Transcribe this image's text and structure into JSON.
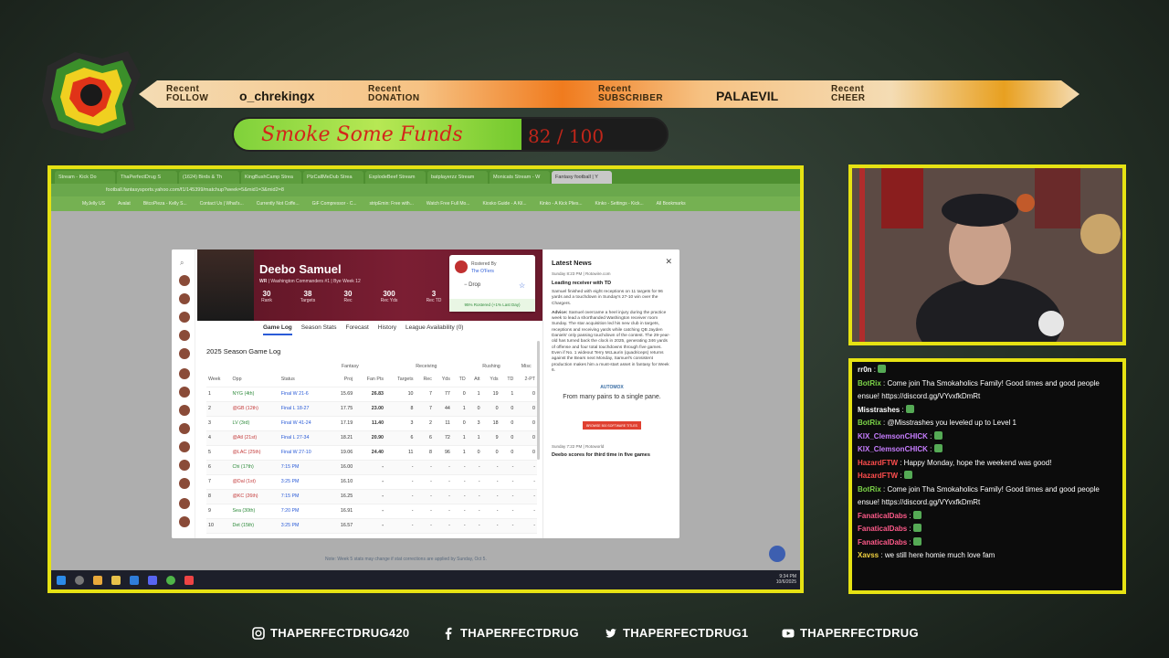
{
  "banner": {
    "items": [
      {
        "label_top": "Recent",
        "label_bottom": "FOLLOW",
        "name": "o_chrekingx"
      },
      {
        "label_top": "Recent",
        "label_bottom": "DONATION",
        "name": ""
      },
      {
        "label_top": "Recent",
        "label_bottom": "SUBSCRIBER",
        "name": "PALAEVIL"
      },
      {
        "label_top": "Recent",
        "label_bottom": "CHEER",
        "name": ""
      }
    ]
  },
  "funds": {
    "title": "Smoke Some Funds",
    "count": "82 / 100",
    "progress": 0.82
  },
  "browser": {
    "tabs": [
      "Stream - Kick Do",
      "ThaPerfectDrug S",
      "(1624) Birds & Th",
      "KingBushCamp Strea",
      "PlzCallMeDub Strea",
      "ExplodeBeef Stream",
      "batplayerzz Stream",
      "Monicats Stream - W",
      "Fantasy football | Y"
    ],
    "url": "football.fantasysports.yahoo.com/f1/145399/matchup?week=5&mid1=3&mid2=8",
    "bookmarks": [
      "MyJelly US",
      "Avalat",
      "BitcoPieza - Kelly S...",
      "Contact Us | What's...",
      "Currently Not Coffe...",
      "GiF Compressor - C...",
      "stripEmin: Free with...",
      "Watch Free Full Mo...",
      "Kiosko Guide - A Kil...",
      "Kinko - A Kick Plies...",
      "Kinko - Settings - Kick...",
      "All Bookmarks"
    ],
    "taskbar_time": "9:34 PM",
    "taskbar_date": "10/6/2025",
    "footer_note": "Note: Week 5 stats may change if stat corrections are applied by Sunday, Oct 5."
  },
  "player": {
    "name": "Deebo Samuel",
    "position": "WR",
    "team": "Washington Commanders #1",
    "bye": "Bye Week 12",
    "stats": [
      {
        "value": "30",
        "label": "Rank"
      },
      {
        "value": "38",
        "label": "Targets"
      },
      {
        "value": "30",
        "label": "Rec"
      },
      {
        "value": "300",
        "label": "Rec Yds"
      },
      {
        "value": "3",
        "label": "Rec TD"
      }
    ],
    "rostered_label": "Rostered By",
    "rostered_team": "The O'Fers",
    "drop_label": "Drop",
    "rostered_pct": "95% Rostered (+1% Last Day)"
  },
  "modal_tabs": [
    "Game Log",
    "Season Stats",
    "Forecast",
    "History",
    "League Availability (0)"
  ],
  "game_log": {
    "title": "2025 Season Game Log",
    "group_headers": [
      "Fantasy",
      "Receiving",
      "Rushing",
      "Misc"
    ],
    "columns": [
      "Week",
      "Opp",
      "Status",
      "Proj",
      "Fan Pts",
      "Targets",
      "Rec",
      "Yds",
      "TD",
      "Att",
      "Yds",
      "TD",
      "2-PT"
    ],
    "rows": [
      [
        "1",
        "NYG (4th)",
        "Final W 21-6",
        "15.69",
        "26.83",
        "10",
        "7",
        "77",
        "0",
        "1",
        "19",
        "1",
        "0"
      ],
      [
        "2",
        "@GB (12th)",
        "Final L 18-27",
        "17.75",
        "23.00",
        "8",
        "7",
        "44",
        "1",
        "0",
        "0",
        "0",
        "0"
      ],
      [
        "3",
        "LV (3rd)",
        "Final W 41-24",
        "17.19",
        "11.40",
        "3",
        "2",
        "11",
        "0",
        "3",
        "18",
        "0",
        "0"
      ],
      [
        "4",
        "@Atl (21st)",
        "Final L 27-34",
        "18.21",
        "20.90",
        "6",
        "6",
        "72",
        "1",
        "1",
        "9",
        "0",
        "0"
      ],
      [
        "5",
        "@LAC (25th)",
        "Final W 27-10",
        "19.06",
        "24.40",
        "11",
        "8",
        "96",
        "1",
        "0",
        "0",
        "0",
        "0"
      ],
      [
        "6",
        "Chi (17th)",
        "7:15 PM",
        "16.00",
        "-",
        "-",
        "-",
        "-",
        "-",
        "-",
        "-",
        "-",
        "-"
      ],
      [
        "7",
        "@Dal (1st)",
        "3:25 PM",
        "16.10",
        "-",
        "-",
        "-",
        "-",
        "-",
        "-",
        "-",
        "-",
        "-"
      ],
      [
        "8",
        "@KC (26th)",
        "7:15 PM",
        "16.25",
        "-",
        "-",
        "-",
        "-",
        "-",
        "-",
        "-",
        "-",
        "-"
      ],
      [
        "9",
        "Sea (30th)",
        "7:20 PM",
        "16.91",
        "-",
        "-",
        "-",
        "-",
        "-",
        "-",
        "-",
        "-",
        "-"
      ],
      [
        "10",
        "Det (15th)",
        "3:25 PM",
        "16.57",
        "-",
        "-",
        "-",
        "-",
        "-",
        "-",
        "-",
        "-",
        "-"
      ]
    ]
  },
  "news": {
    "heading": "Latest News",
    "date": "Sunday 8:23 PM | Rotowire.com",
    "headline": "Leading receiver with TD",
    "body": "Samuel finished with eight receptions on 11 targets for 96 yards and a touchdown in Sunday's 27-10 win over the Chargers.",
    "advice_label": "Advice:",
    "advice": "Samuel overcame a heel injury during the practice week to lead a shorthanded Washington receiver room Sunday. The star acquisition led his new club in targets, receptions and receiving yards while catching QB Jayden Daniels' only passing touchdown of the contest. The 29-year-old has turned back the clock in 2025, generating 346 yards of offense and four total touchdowns through five games. Even if No. 1 wideout Terry McLaurin (quadriceps) returns against the Bears next Monday, Samuel's consistent production makes him a must-start asset in fantasy for Week 6.",
    "ad_brand": "AUTOMOX",
    "ad_text": "From many pains to a single pane.",
    "ad_button": "BROWSE 500 SOFTWARE TITLES",
    "date2": "Sunday 7:22 PM | Rotoworld",
    "headline2": "Deebo scores for third time in five games"
  },
  "chat": [
    {
      "user": "rr0n",
      "color": "#ffffff",
      "text": ""
    },
    {
      "user": "BotRix",
      "color": "#7cd548",
      "text": "Come join Tha Smokaholics Family! Good times and good people ensue! https://discord.gg/VYvxfkDmRt"
    },
    {
      "user": "Misstrashes",
      "color": "#ffffff",
      "text": ""
    },
    {
      "user": "BotRix",
      "color": "#7cd548",
      "text": "@Misstrashes you leveled up to Level 1"
    },
    {
      "user": "KIX_ClemsonCHICK",
      "color": "#c77dff",
      "text": ""
    },
    {
      "user": "KIX_ClemsonCHICK",
      "color": "#c77dff",
      "text": ""
    },
    {
      "user": "HazardFTW",
      "color": "#ff4d4d",
      "text": "Happy Monday, hope the weekend was good!"
    },
    {
      "user": "HazardFTW",
      "color": "#ff4d4d",
      "text": ""
    },
    {
      "user": "BotRix",
      "color": "#7cd548",
      "text": "Come join Tha Smokaholics Family! Good times and good people ensue! https://discord.gg/VYvxfkDmRt"
    },
    {
      "user": "FanaticalDabs",
      "color": "#ff5a8a",
      "text": ""
    },
    {
      "user": "FanaticalDabs",
      "color": "#ff5a8a",
      "text": ""
    },
    {
      "user": "FanaticalDabs",
      "color": "#ff5a8a",
      "text": ""
    },
    {
      "user": "Xavss",
      "color": "#f0d040",
      "text": "we still here homie much love fam"
    }
  ],
  "socials": [
    {
      "icon": "instagram-icon",
      "handle": "THAPERFECTDRUG420"
    },
    {
      "icon": "facebook-icon",
      "handle": "THAPERFECTDRUG"
    },
    {
      "icon": "twitter-icon",
      "handle": "THAPERFECTDRUG1"
    },
    {
      "icon": "youtube-icon",
      "handle": "THAPERFECTDRUG"
    }
  ],
  "colors": {
    "frame": "#e6e213",
    "hero": "#7b1e33",
    "link": "#2a5bd7",
    "chrome": "#4e8f31"
  }
}
